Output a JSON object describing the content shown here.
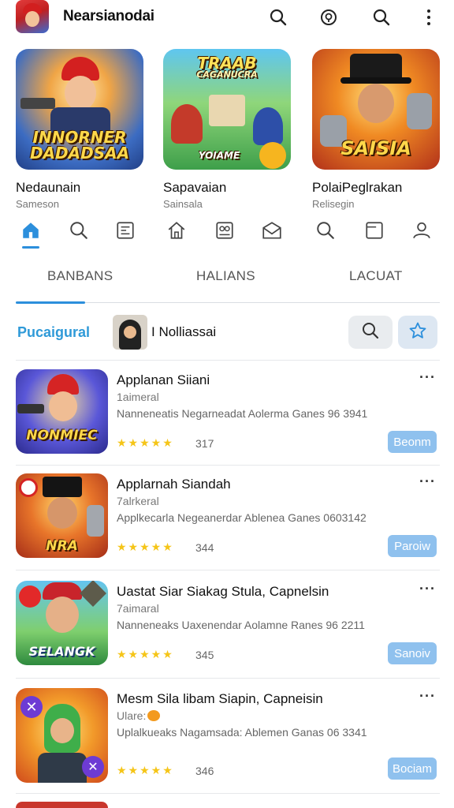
{
  "header": {
    "app_title": "Nearsianodai",
    "icons": [
      "search-icon",
      "badge-icon",
      "search-icon",
      "more-vert-icon"
    ]
  },
  "featured": [
    {
      "name": "Nedaunain",
      "sub": "Sameson",
      "art": [
        "INNORNER",
        "DADADSAA"
      ]
    },
    {
      "name": "Sapavaian",
      "sub": "Sainsala",
      "art": [
        "TRAAB",
        "CAGANUCRA",
        "YOIAME"
      ]
    },
    {
      "name": "PolaiPeglrakan",
      "sub": "Relisegin",
      "art": [
        "SAISIA"
      ]
    }
  ],
  "iconnav": [
    "home-icon",
    "search-icon",
    "news-icon",
    "house-icon",
    "gallery-icon",
    "mail-icon",
    "search-icon",
    "square-icon",
    "profile-icon"
  ],
  "tabs": [
    "BANBANS",
    "HALIANS",
    "LACUAT"
  ],
  "filter": {
    "label": "Pucaigural",
    "user": "I Nolliassai"
  },
  "list": [
    {
      "title": "Applanan Siiani",
      "sub": "1aimeral",
      "desc": "Nanneneatis Negarneadat Aolerma Ganes 96 3941",
      "stars": "★★★★★",
      "rating": "317",
      "button": "Beonm",
      "art": "NONMIEC"
    },
    {
      "title": "Applarnah Siandah",
      "sub": "7alrkeral",
      "desc": "Applkecarla Negeanerdar Ablenea Ganes 0603142",
      "stars": "★★★★★",
      "rating": "344",
      "button": "Paroiw",
      "art": "NRA"
    },
    {
      "title": "Uastat Siar Siakag Stula, Capnelsin",
      "sub": "7aimaral",
      "desc": "Nanneneaks Uaxenendar Aolamne Ranes 96 2211",
      "stars": "★★★★★",
      "rating": "345",
      "button": "Sanoiv",
      "art": "SELANGK"
    },
    {
      "title": "Mesm Sila libam Siapin, Capneisin",
      "sub": "Ulare:",
      "desc": "Uplalkueaks Nagamsada: Ablemen Ganas 06 3341",
      "stars": "★★★★★",
      "rating": "346",
      "button": "Bociam",
      "art": ""
    }
  ],
  "colors": {
    "accent": "#2c8fdc",
    "star": "#f5c518",
    "button": "#8fc1ee"
  }
}
